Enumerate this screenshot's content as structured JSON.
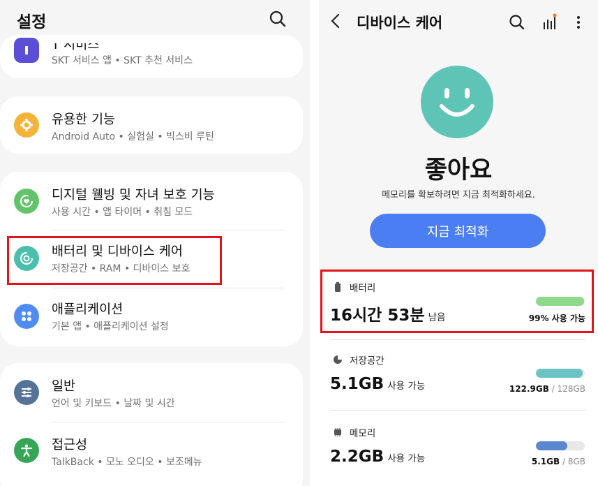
{
  "settings": {
    "title": "설정",
    "partial_item": {
      "title": "T 서비스",
      "subtitle": "SKT 서비스 앱 • SKT 추천 서비스"
    },
    "items": [
      {
        "title": "유용한 기능",
        "subtitle": "Android Auto • 실험실 • 빅스비 루틴",
        "icon": "star-gear-icon",
        "color": "#f5b33a"
      },
      {
        "title": "디지털 웰빙 및 자녀 보호 기능",
        "subtitle": "사용 시간 • 앱 타이머 • 취침 모드",
        "icon": "wellbeing-heart-icon",
        "color": "#62c46a"
      },
      {
        "title": "배터리 및 디바이스 케어",
        "subtitle": "저장공간 • RAM • 디바이스 보호",
        "icon": "device-care-icon",
        "color": "#4bbfae"
      },
      {
        "title": "애플리케이션",
        "subtitle": "기본 앱 • 애플리케이션 설정",
        "icon": "apps-grid-icon",
        "color": "#4e8cf1"
      },
      {
        "title": "일반",
        "subtitle": "언어 및 키보드 • 날짜 및 시간",
        "icon": "sliders-icon",
        "color": "#557399"
      },
      {
        "title": "접근성",
        "subtitle": "TalkBack • 모노 오디오 • 보조메뉴",
        "icon": "accessibility-icon",
        "color": "#36a656"
      }
    ],
    "partial_icon_color": "#5a4fd6"
  },
  "device_care": {
    "title": "디바이스 케어",
    "status": "좋아요",
    "status_message": "메모리를 확보하려면 지금 최적화하세요.",
    "optimize_button": "지금 최적화",
    "smiley_color": "#5ec4b6",
    "battery": {
      "label": "배터리",
      "value": "16시간 53분",
      "unit": "남음",
      "detail": "99% 사용 가능",
      "fill": 0.99,
      "color": "#8ed98c"
    },
    "storage": {
      "label": "저장공간",
      "value": "5.1GB",
      "unit": "사용 가능",
      "used": "122.9GB",
      "total": "/ 128GB",
      "fill": 0.96,
      "color": "#6dc3c3"
    },
    "memory": {
      "label": "메모리",
      "value": "2.2GB",
      "unit": "사용 가능",
      "used": "5.1GB",
      "total": "/ 8GB",
      "fill": 0.64,
      "color": "#5b87cf"
    },
    "notification_dot_color": "#ef7b2c"
  }
}
